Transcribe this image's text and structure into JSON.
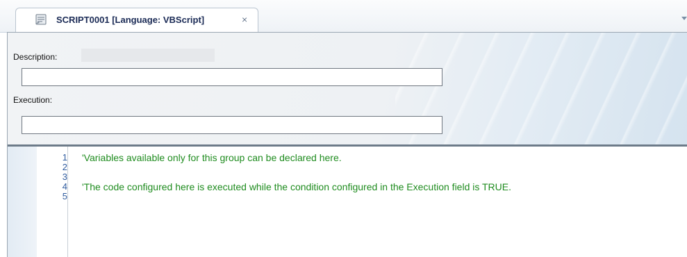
{
  "tab": {
    "title": "SCRIPT0001 [Language: VBScript]",
    "close_glyph": "×",
    "icon": "script-icon"
  },
  "form": {
    "description_label": "Description:",
    "description_value": "",
    "execution_label": "Execution:",
    "execution_value": ""
  },
  "editor": {
    "lines": [
      {
        "number": "1",
        "text": "'Variables available only for this group can be declared here."
      },
      {
        "number": "2",
        "text": ""
      },
      {
        "number": "3",
        "text": ""
      },
      {
        "number": "4",
        "text": "'The code configured here is executed while the condition configured in the Execution field is TRUE."
      },
      {
        "number": "5",
        "text": ""
      }
    ]
  },
  "colors": {
    "code_comment": "#1f8c1f",
    "line_numbers": "#2d5a9e",
    "tab_title": "#1a2a55"
  }
}
